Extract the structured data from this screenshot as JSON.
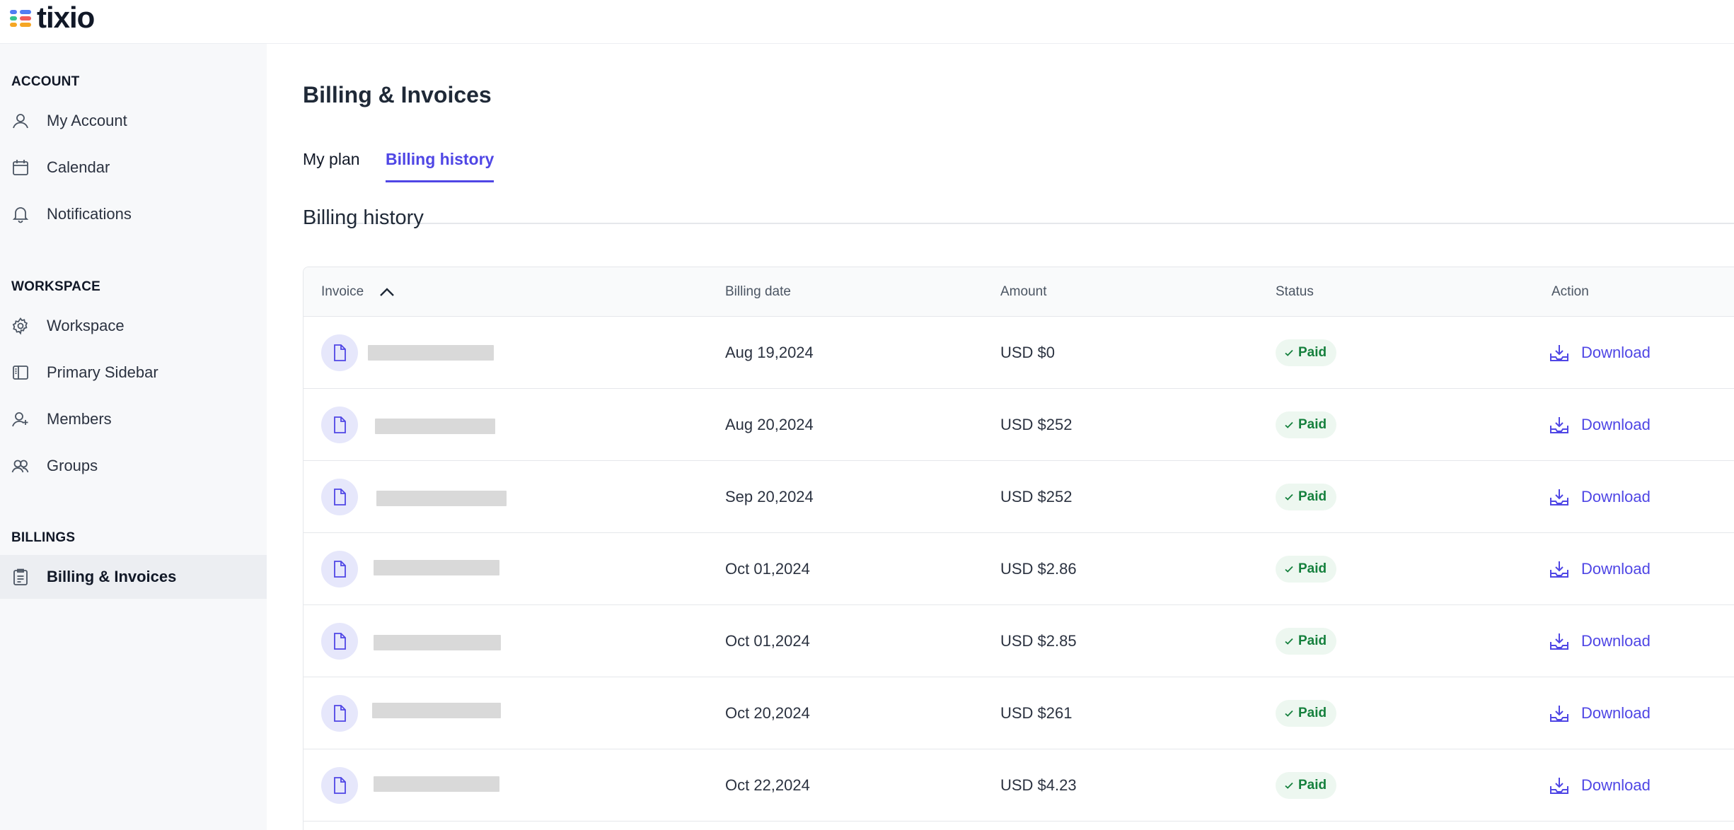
{
  "app": {
    "name": "tixio"
  },
  "sidebar": {
    "sections": [
      {
        "title": "ACCOUNT",
        "items": [
          {
            "label": "My Account",
            "icon": "user-icon"
          },
          {
            "label": "Calendar",
            "icon": "calendar-icon"
          },
          {
            "label": "Notifications",
            "icon": "bell-icon"
          }
        ]
      },
      {
        "title": "WORKSPACE",
        "items": [
          {
            "label": "Workspace",
            "icon": "gear-icon"
          },
          {
            "label": "Primary Sidebar",
            "icon": "sidebar-icon"
          },
          {
            "label": "Members",
            "icon": "add-user-icon"
          },
          {
            "label": "Groups",
            "icon": "users-icon"
          }
        ]
      },
      {
        "title": "BILLINGS",
        "items": [
          {
            "label": "Billing & Invoices",
            "icon": "clipboard-icon",
            "active": true
          }
        ]
      }
    ]
  },
  "main": {
    "title": "Billing & Invoices",
    "tabs": [
      {
        "label": "My plan",
        "active": false
      },
      {
        "label": "Billing history",
        "active": true
      }
    ],
    "section_heading": "Billing history"
  },
  "table": {
    "columns": [
      "Invoice",
      "Billing date",
      "Amount",
      "Status",
      "Action"
    ],
    "sort": {
      "column": "Invoice",
      "direction": "ascending"
    },
    "rows": [
      {
        "invoice": "",
        "billing_date": "Aug 19,2024",
        "amount": "USD $0",
        "status": "Paid",
        "action": "Download"
      },
      {
        "invoice": "",
        "billing_date": "Aug 20,2024",
        "amount": "USD $252",
        "status": "Paid",
        "action": "Download"
      },
      {
        "invoice": "",
        "billing_date": "Sep 20,2024",
        "amount": "USD $252",
        "status": "Paid",
        "action": "Download"
      },
      {
        "invoice": "",
        "billing_date": "Oct 01,2024",
        "amount": "USD $2.86",
        "status": "Paid",
        "action": "Download"
      },
      {
        "invoice": "",
        "billing_date": "Oct 01,2024",
        "amount": "USD $2.85",
        "status": "Paid",
        "action": "Download"
      },
      {
        "invoice": "",
        "billing_date": "Oct 20,2024",
        "amount": "USD $261",
        "status": "Paid",
        "action": "Download"
      },
      {
        "invoice": "",
        "billing_date": "Oct 22,2024",
        "amount": "USD $4.23",
        "status": "Paid",
        "action": "Download"
      }
    ]
  },
  "colors": {
    "accent": "#4f46e5",
    "paid_text": "#15803d",
    "paid_bg": "#edf7f0",
    "sidebar_bg": "#f7f8fa",
    "file_icon_bg": "#e6e7fb",
    "logo_colors": [
      "#4f7df3",
      "#f5a623",
      "#34c38f",
      "#ef5b5b"
    ]
  }
}
